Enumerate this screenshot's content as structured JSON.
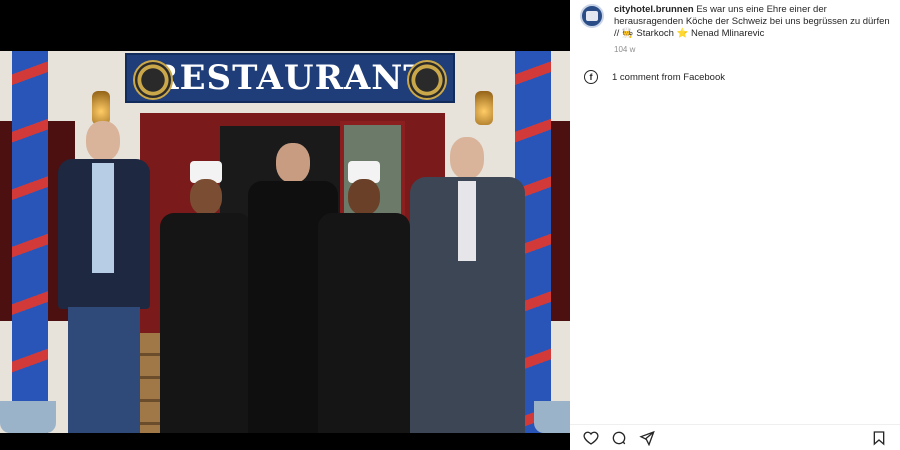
{
  "post": {
    "username": "cityhotel.brunnen",
    "caption": " Es war uns eine Ehre einer der herausragenden Köche der Schweiz bei uns begrüssen zu dürfen // ",
    "tag1": "🧑‍🍳 Starkoch ",
    "tag2": "⭐ Nenad Mlinarevic",
    "time": "104 w",
    "comments_label": "1 comment from Facebook"
  },
  "photo": {
    "sign_text": "RESTAURANT"
  },
  "icons": {
    "avatar": "hotel-avatar-icon",
    "facebook": "facebook-icon",
    "like": "heart-icon",
    "comment": "comment-icon",
    "share": "share-icon",
    "save": "bookmark-icon"
  }
}
